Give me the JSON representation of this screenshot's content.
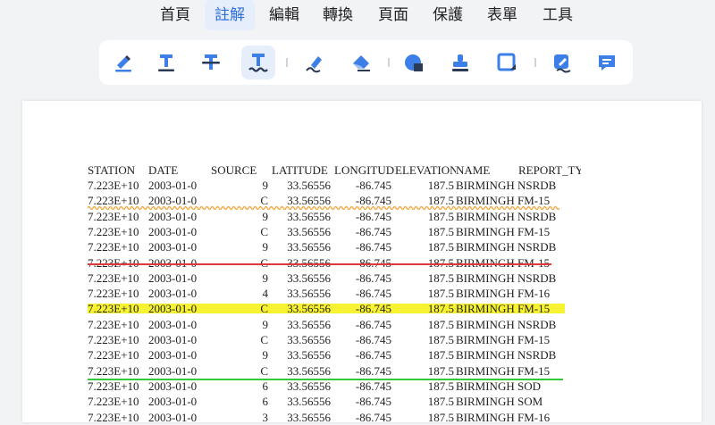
{
  "menu": {
    "items": [
      {
        "id": "home",
        "label": "首頁"
      },
      {
        "id": "annotate",
        "label": "註解"
      },
      {
        "id": "edit",
        "label": "編輯"
      },
      {
        "id": "convert",
        "label": "轉換"
      },
      {
        "id": "page",
        "label": "頁面"
      },
      {
        "id": "protect",
        "label": "保護"
      },
      {
        "id": "form",
        "label": "表單"
      },
      {
        "id": "tools",
        "label": "工具"
      }
    ],
    "active": "annotate"
  },
  "toolbar": {
    "tools": [
      {
        "icon": "highlight-icon"
      },
      {
        "icon": "underline-text-icon"
      },
      {
        "icon": "strikethrough-text-icon"
      },
      {
        "icon": "squiggly-text-icon"
      },
      {
        "icon": "pen-icon"
      },
      {
        "icon": "eraser-icon"
      },
      {
        "icon": "shape-icon"
      },
      {
        "icon": "stamp-icon"
      },
      {
        "icon": "area-icon"
      },
      {
        "icon": "signature-icon"
      },
      {
        "icon": "comment-icon"
      }
    ],
    "active_tool": "squiggly-text-icon"
  },
  "colors": {
    "accent": "#2f6fdd",
    "squiggly": "#f5a53a",
    "strike": "#e0373a",
    "highlight": "#f7f232",
    "underline": "#37c93c"
  },
  "document": {
    "headers": [
      "STATION",
      "DATE",
      "SOURCE",
      "LATITUDE",
      "LONGITUDE",
      "ELEVATION",
      "NAME",
      "REPORT_TYP"
    ],
    "rows": [
      {
        "station": "7.223E+10",
        "date": "2003-01-0",
        "source": "9",
        "lat": "33.56556",
        "lon": "-86.745",
        "elev": "187.5",
        "name": "BIRMINGHAM",
        "report": "NSRDB",
        "mark": "none"
      },
      {
        "station": "7.223E+10",
        "date": "2003-01-0",
        "source": "C",
        "lat": "33.56556",
        "lon": "-86.745",
        "elev": "187.5",
        "name": "BIRMINGHAM",
        "report": "FM-15",
        "mark": "squiggly"
      },
      {
        "station": "7.223E+10",
        "date": "2003-01-0",
        "source": "9",
        "lat": "33.56556",
        "lon": "-86.745",
        "elev": "187.5",
        "name": "BIRMINGHAM",
        "report": "NSRDB",
        "mark": "none"
      },
      {
        "station": "7.223E+10",
        "date": "2003-01-0",
        "source": "C",
        "lat": "33.56556",
        "lon": "-86.745",
        "elev": "187.5",
        "name": "BIRMINGHAM",
        "report": "FM-15",
        "mark": "none"
      },
      {
        "station": "7.223E+10",
        "date": "2003-01-0",
        "source": "9",
        "lat": "33.56556",
        "lon": "-86.745",
        "elev": "187.5",
        "name": "BIRMINGHAM",
        "report": "NSRDB",
        "mark": "none"
      },
      {
        "station": "7.223E+10",
        "date": "2003-01-0",
        "source": "C",
        "lat": "33.56556",
        "lon": "-86.745",
        "elev": "187.5",
        "name": "BIRMINGHAM",
        "report": "FM-15",
        "mark": "strike"
      },
      {
        "station": "7.223E+10",
        "date": "2003-01-0",
        "source": "9",
        "lat": "33.56556",
        "lon": "-86.745",
        "elev": "187.5",
        "name": "BIRMINGHAM",
        "report": "NSRDB",
        "mark": "none"
      },
      {
        "station": "7.223E+10",
        "date": "2003-01-0",
        "source": "4",
        "lat": "33.56556",
        "lon": "-86.745",
        "elev": "187.5",
        "name": "BIRMINGHAM",
        "report": "FM-16",
        "mark": "none"
      },
      {
        "station": "7.223E+10",
        "date": "2003-01-0",
        "source": "C",
        "lat": "33.56556",
        "lon": "-86.745",
        "elev": "187.5",
        "name": "BIRMINGHAM",
        "report": "FM-15",
        "mark": "highlight"
      },
      {
        "station": "7.223E+10",
        "date": "2003-01-0",
        "source": "9",
        "lat": "33.56556",
        "lon": "-86.745",
        "elev": "187.5",
        "name": "BIRMINGHAM",
        "report": "NSRDB",
        "mark": "none"
      },
      {
        "station": "7.223E+10",
        "date": "2003-01-0",
        "source": "C",
        "lat": "33.56556",
        "lon": "-86.745",
        "elev": "187.5",
        "name": "BIRMINGHAM",
        "report": "FM-15",
        "mark": "none"
      },
      {
        "station": "7.223E+10",
        "date": "2003-01-0",
        "source": "9",
        "lat": "33.56556",
        "lon": "-86.745",
        "elev": "187.5",
        "name": "BIRMINGHAM",
        "report": "NSRDB",
        "mark": "none"
      },
      {
        "station": "7.223E+10",
        "date": "2003-01-0",
        "source": "C",
        "lat": "33.56556",
        "lon": "-86.745",
        "elev": "187.5",
        "name": "BIRMINGHAM",
        "report": "FM-15",
        "mark": "underline"
      },
      {
        "station": "7.223E+10",
        "date": "2003-01-0",
        "source": "6",
        "lat": "33.56556",
        "lon": "-86.745",
        "elev": "187.5",
        "name": "BIRMINGHAM",
        "report": "SOD",
        "mark": "none"
      },
      {
        "station": "7.223E+10",
        "date": "2003-01-0",
        "source": "6",
        "lat": "33.56556",
        "lon": "-86.745",
        "elev": "187.5",
        "name": "BIRMINGHAM",
        "report": "SOM",
        "mark": "none"
      },
      {
        "station": "7.223E+10",
        "date": "2003-01-0",
        "source": "3",
        "lat": "33.56556",
        "lon": "-86.745",
        "elev": "187.5",
        "name": "BIRMINGHAM",
        "report": "FM-16",
        "mark": "none"
      }
    ]
  }
}
